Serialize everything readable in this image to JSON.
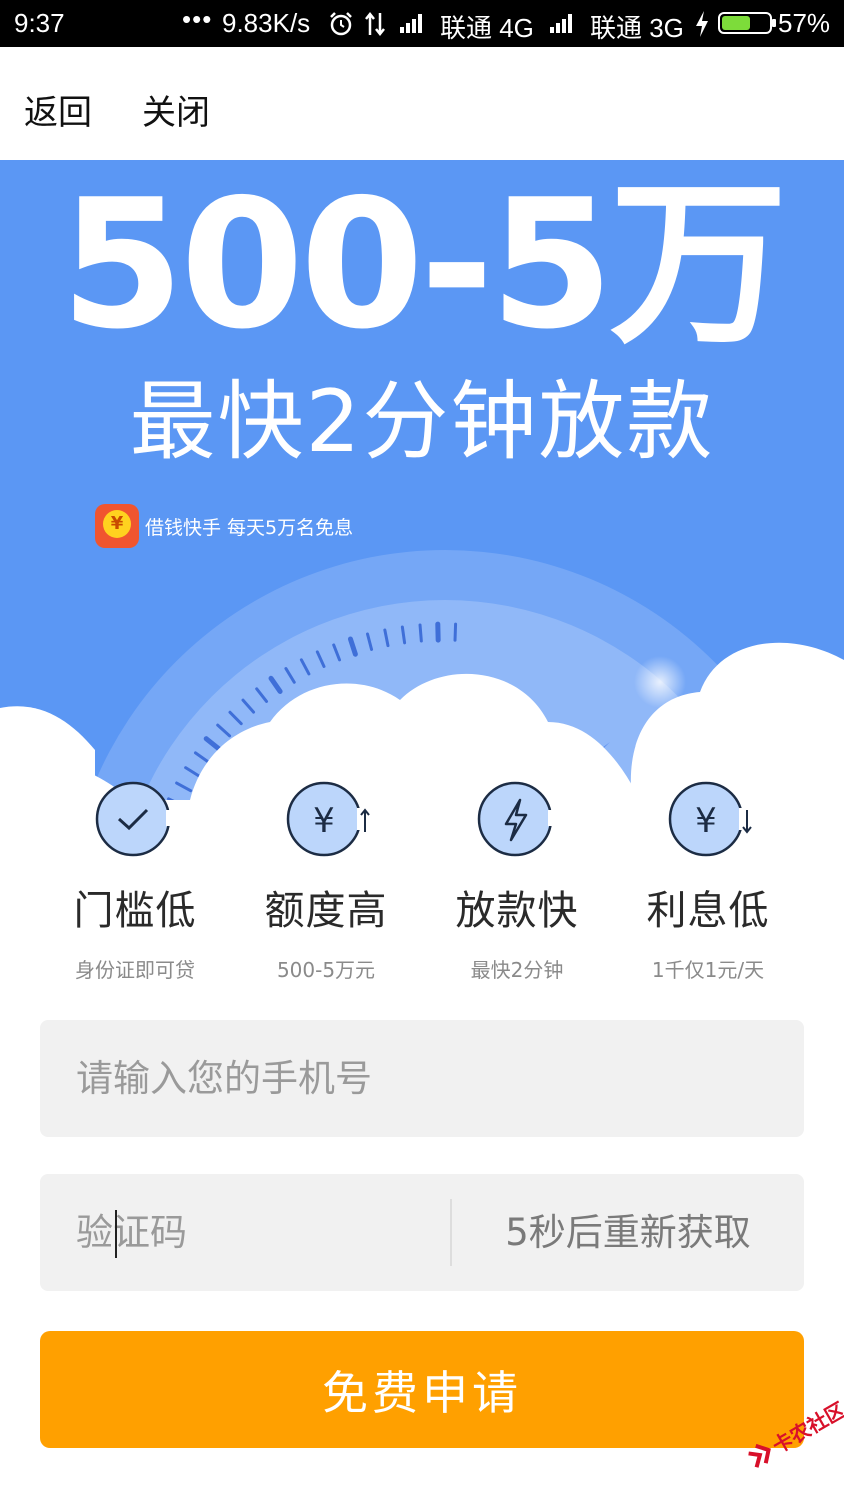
{
  "status_bar": {
    "time": "9:37",
    "dots": "•••",
    "speed": "9.83K/s",
    "carrier1": "联通 4G",
    "carrier2": "联通 3G",
    "battery": "57%"
  },
  "nav": {
    "back": "返回",
    "close": "关闭"
  },
  "hero": {
    "amount": "500-5万",
    "slogan": "最快2分钟放款",
    "brand_text": "借钱快手  每天5万名免息",
    "brand_logo_glyph": "¥",
    "colors": {
      "background": "#5b97f4",
      "cloud": "#ffffff"
    }
  },
  "features": [
    {
      "icon": "check-icon",
      "title": "门槛低",
      "subtitle": "身份证即可贷"
    },
    {
      "icon": "yuan-up-icon",
      "glyph": "¥",
      "title": "额度高",
      "subtitle": "500-5万元"
    },
    {
      "icon": "lightning-icon",
      "title": "放款快",
      "subtitle": "最快2分钟"
    },
    {
      "icon": "yuan-down-icon",
      "glyph": "¥",
      "title": "利息低",
      "subtitle": "1千仅1元/天"
    }
  ],
  "form": {
    "phone_placeholder": "请输入您的手机号",
    "phone_value": "",
    "code_placeholder": "验证码",
    "code_value": "",
    "resend_label": "5秒后重新获取",
    "submit_label": "免费申请"
  },
  "colors": {
    "primary": "#ffa000",
    "field_bg": "#f1f1f1",
    "icon_fill": "#bcd6fb"
  },
  "watermark": {
    "text": "卡农社区"
  }
}
